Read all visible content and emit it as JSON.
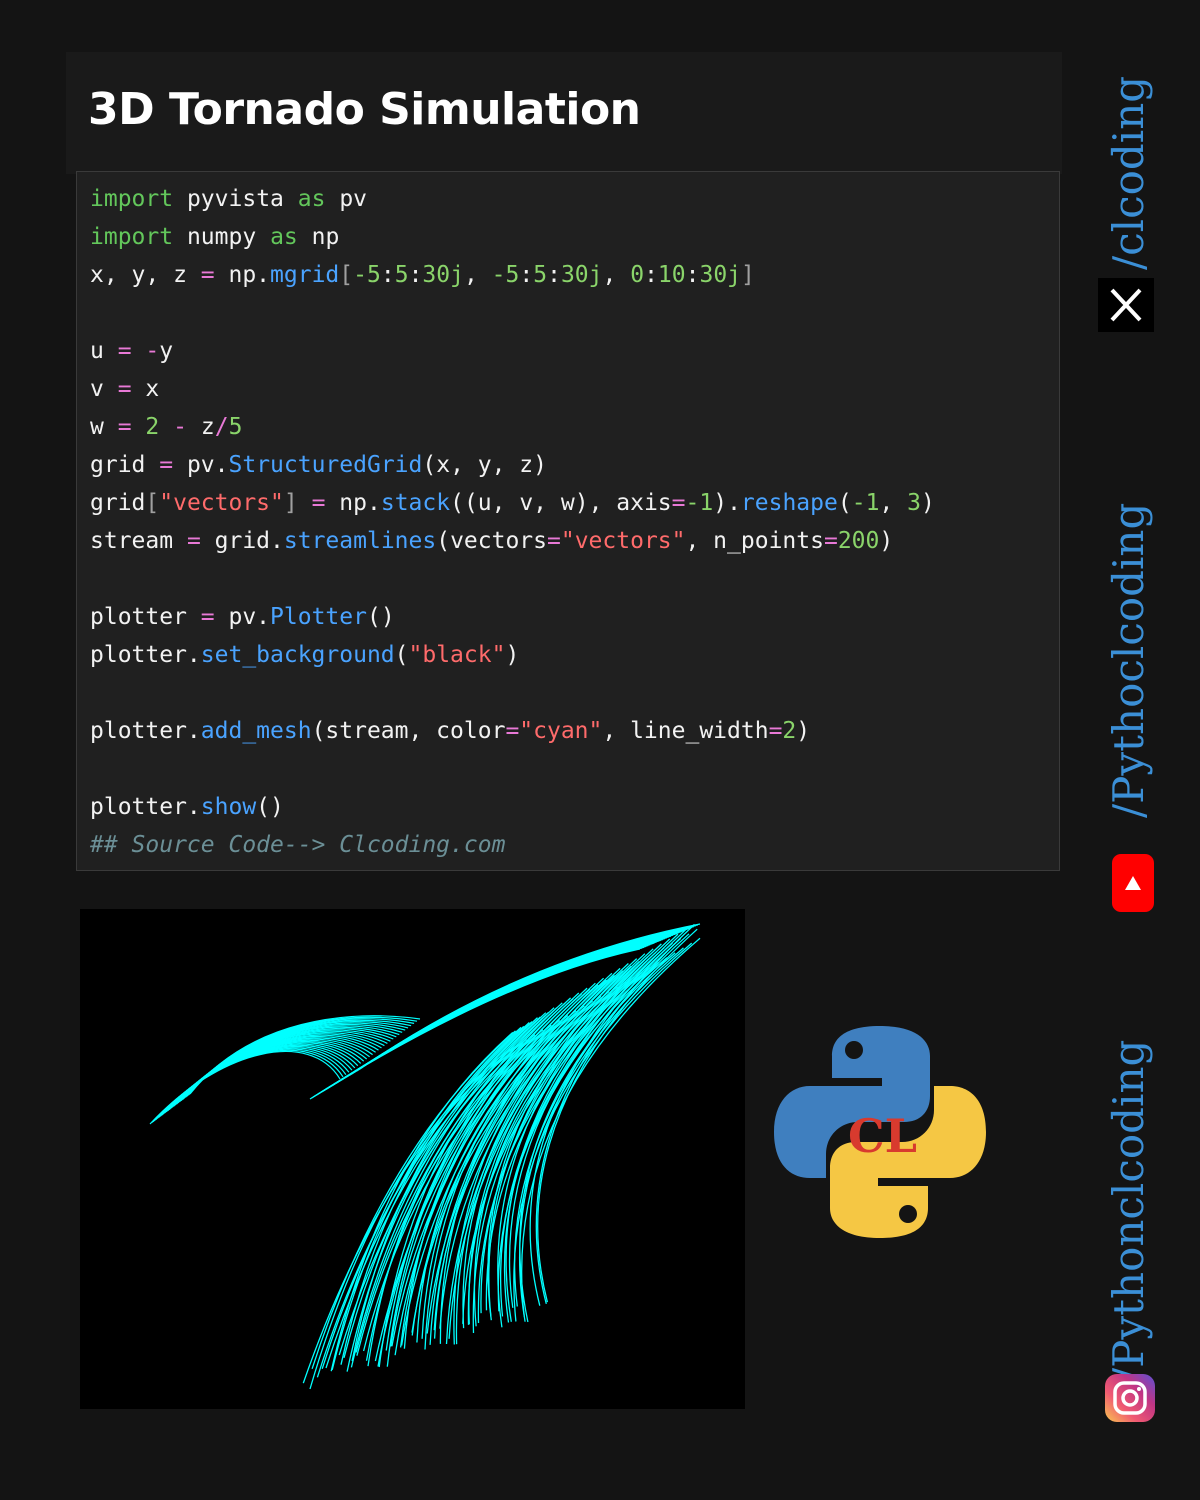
{
  "title": "3D Tornado Simulation",
  "code_lines": [
    "import pyvista as pv",
    "import numpy as np",
    "x, y, z = np.mgrid[-5:5:30j, -5:5:30j, 0:10:30j]",
    "",
    "u = -y",
    "v = x",
    "w = 2 - z/5",
    "grid = pv.StructuredGrid(x, y, z)",
    "grid[\"vectors\"] = np.stack((u, v, w), axis=-1).reshape(-1, 3)",
    "stream = grid.streamlines(vectors=\"vectors\", n_points=200)",
    "",
    "plotter = pv.Plotter()",
    "plotter.set_background(\"black\")",
    "",
    "plotter.add_mesh(stream, color=\"cyan\", line_width=2)",
    "",
    "plotter.show()",
    "## Source Code--> Clcoding.com"
  ],
  "sidebar": {
    "x_handle": "/clcoding",
    "youtube_handle": "/Pythoclcoding",
    "instagram_handle": "/Pythonclcoding"
  },
  "logo": {
    "text": "CL"
  },
  "colors": {
    "accent": "#3b8fd6",
    "stream": "#00ffff",
    "youtube": "#ff0000"
  },
  "icons": [
    "x-twitter-icon",
    "youtube-icon",
    "instagram-icon",
    "python-logo-icon"
  ]
}
